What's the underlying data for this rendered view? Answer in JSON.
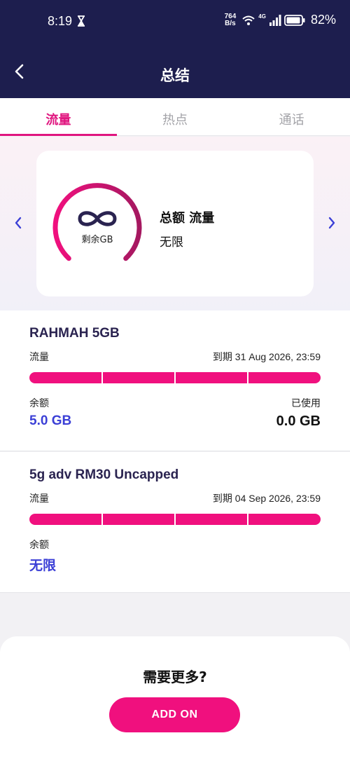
{
  "status_bar": {
    "time": "8:19",
    "speed_value": "764",
    "speed_unit": "B/s",
    "network": "4G",
    "battery": "82%"
  },
  "header": {
    "title": "总结",
    "back_icon": "chevron-left-icon"
  },
  "tabs": [
    {
      "label": "流量",
      "active": true
    },
    {
      "label": "热点",
      "active": false
    },
    {
      "label": "通话",
      "active": false
    }
  ],
  "summary_card": {
    "icon": "infinity-icon",
    "gauge_label": "剩余GB",
    "title": "总额 流量",
    "value": "无限"
  },
  "plans": [
    {
      "name": "RAHMAH 5GB",
      "type": "流量",
      "expiry": "到期 31 Aug 2026, 23:59",
      "remaining_label": "余额",
      "remaining_value": "5.0 GB",
      "used_label": "已使用",
      "used_value": "0.0 GB"
    },
    {
      "name": "5g adv RM30 Uncapped",
      "type": "流量",
      "expiry": "到期 04 Sep 2026, 23:59",
      "remaining_label": "余额",
      "remaining_value": "无限"
    }
  ],
  "sheet": {
    "title": "需要更多?",
    "button_label": "ADD ON"
  },
  "colors": {
    "navy": "#1d1e4e",
    "accent": "#e0157f",
    "bar": "#f0107e",
    "value_blue": "#3b3fd6"
  }
}
